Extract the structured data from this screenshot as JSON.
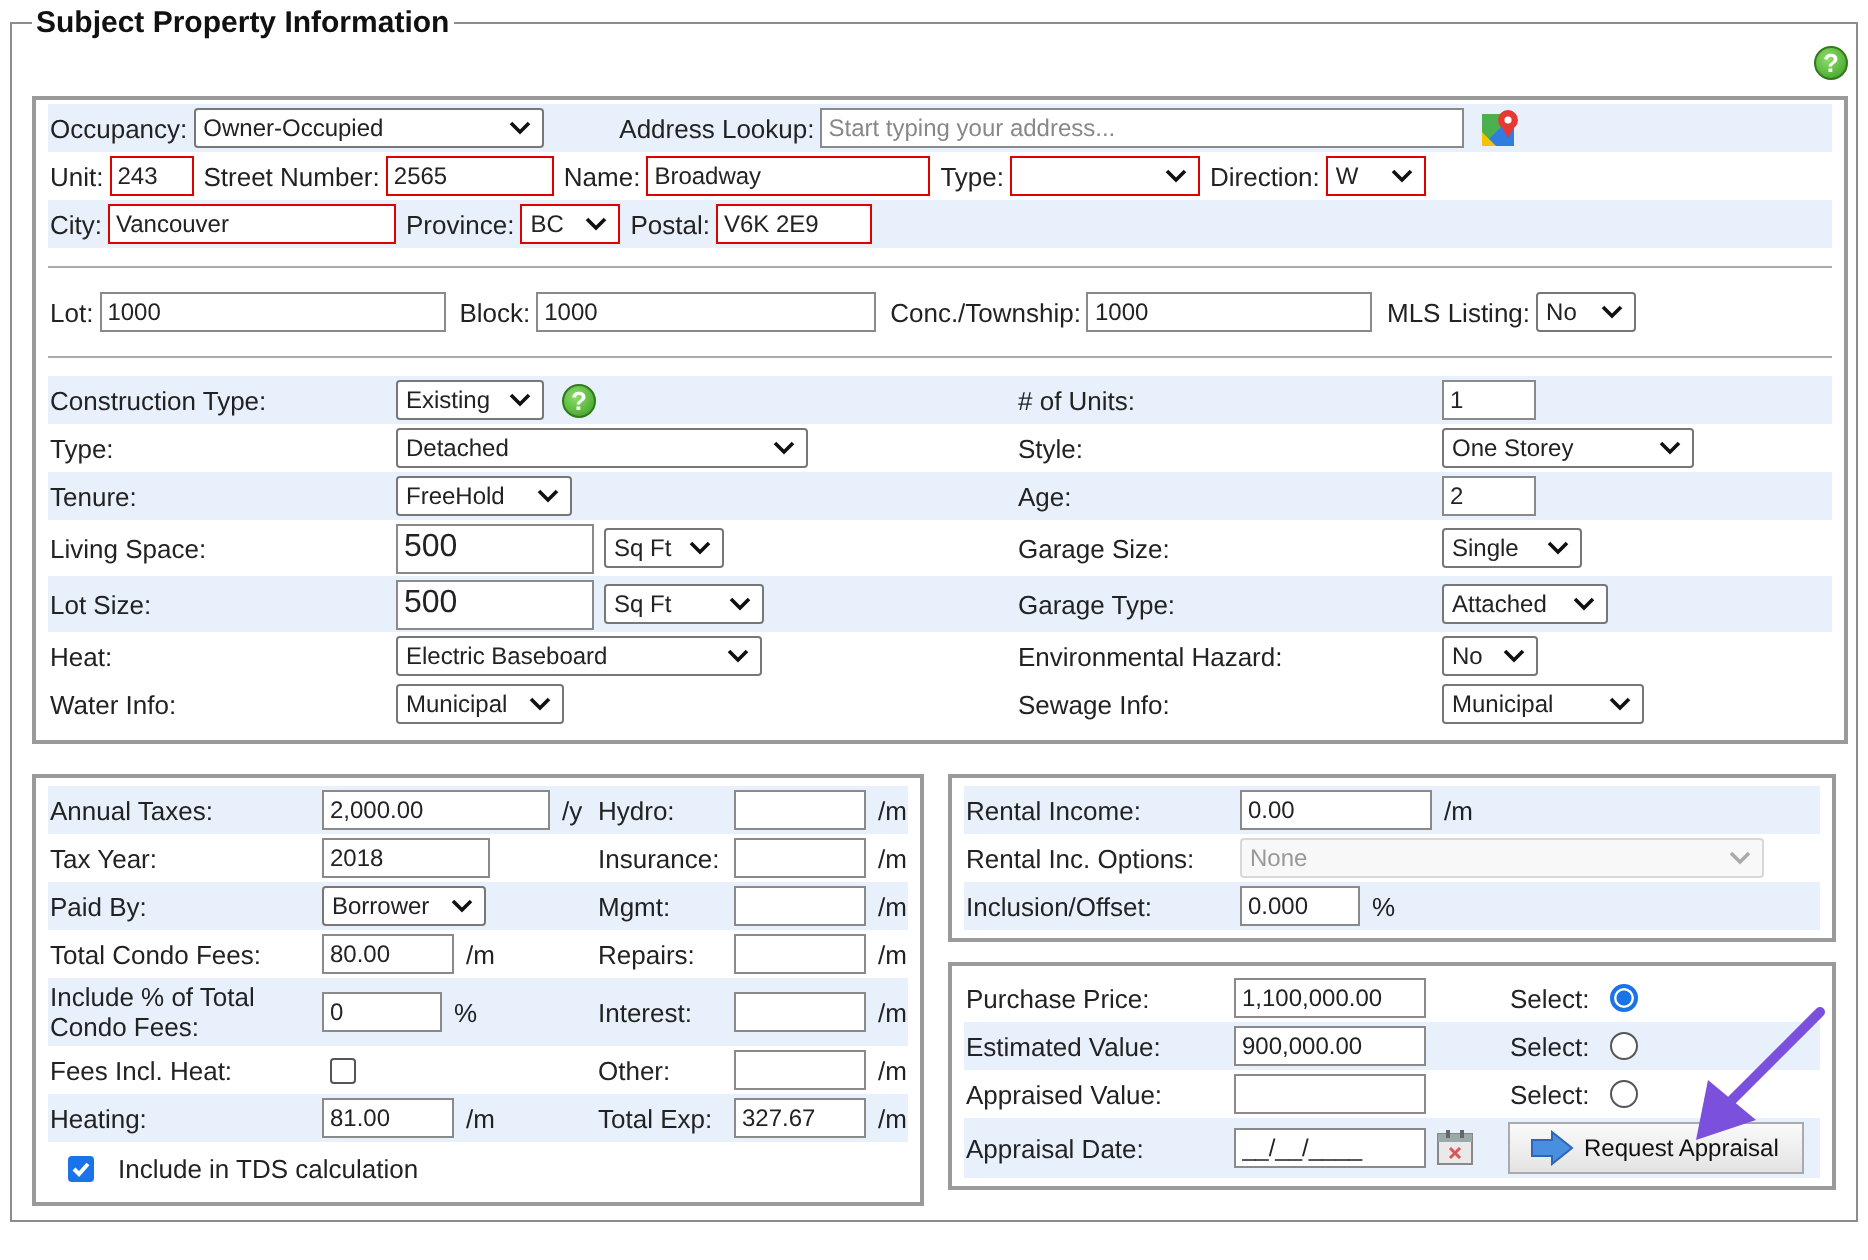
{
  "legend": "Subject Property Information",
  "help": "?",
  "address": {
    "rows": [
      {
        "shaded": true,
        "fields": [
          {
            "label": "Occupancy:",
            "kind": "select",
            "value": "Owner-Occupied"
          },
          {
            "label": "Address Lookup:",
            "kind": "text",
            "placeholder": "Start typing your address...",
            "map_button": true
          }
        ]
      },
      {
        "shaded": false,
        "fields": [
          {
            "label": "Unit:",
            "kind": "text",
            "value": "243",
            "invalid": true
          },
          {
            "label": "Street Number:",
            "kind": "text",
            "value": "2565",
            "invalid": true
          },
          {
            "label": "Name:",
            "kind": "text",
            "value": "Broadway",
            "invalid": true
          },
          {
            "label": "Type:",
            "kind": "select",
            "invalid": true
          },
          {
            "label": "Direction:",
            "kind": "select",
            "value": "W",
            "invalid": true
          }
        ]
      },
      {
        "shaded": true,
        "fields": [
          {
            "label": "City:",
            "kind": "text",
            "value": "Vancouver",
            "invalid": true
          },
          {
            "label": "Province:",
            "kind": "select",
            "value": "BC",
            "invalid": true
          },
          {
            "label": "Postal:",
            "kind": "text",
            "value": "V6K 2E9",
            "invalid": true
          }
        ]
      }
    ],
    "lot_row": [
      {
        "label": "Lot:",
        "kind": "text",
        "value": "1000"
      },
      {
        "label": "Block:",
        "kind": "text",
        "value": "1000"
      },
      {
        "label": "Conc./Township:",
        "kind": "text",
        "value": "1000"
      },
      {
        "label": "MLS Listing:",
        "kind": "select",
        "value": "No"
      }
    ]
  },
  "details": [
    {
      "shaded": true,
      "left": {
        "label": "Construction Type:",
        "controls": [
          {
            "kind": "select",
            "value": "Existing"
          }
        ],
        "help": "?"
      },
      "right": {
        "label": "# of Units:",
        "controls": [
          {
            "kind": "text",
            "value": "1"
          }
        ]
      }
    },
    {
      "shaded": false,
      "left": {
        "label": "Type:",
        "controls": [
          {
            "kind": "select",
            "value": "Detached"
          }
        ]
      },
      "right": {
        "label": "Style:",
        "controls": [
          {
            "kind": "select",
            "value": "One Storey"
          }
        ]
      }
    },
    {
      "shaded": true,
      "left": {
        "label": "Tenure:",
        "controls": [
          {
            "kind": "select",
            "value": "FreeHold"
          }
        ]
      },
      "right": {
        "label": "Age:",
        "controls": [
          {
            "kind": "text",
            "value": "2"
          }
        ]
      }
    },
    {
      "shaded": false,
      "left": {
        "label": "Living Space:",
        "controls": [
          {
            "kind": "text",
            "value": "500"
          },
          {
            "kind": "select",
            "value": "Sq Ft"
          }
        ]
      },
      "right": {
        "label": "Garage Size:",
        "controls": [
          {
            "kind": "select",
            "value": "Single"
          }
        ]
      }
    },
    {
      "shaded": true,
      "left": {
        "label": "Lot Size:",
        "controls": [
          {
            "kind": "text",
            "value": "500"
          },
          {
            "kind": "select",
            "value": "Sq Ft"
          }
        ]
      },
      "right": {
        "label": "Garage Type:",
        "controls": [
          {
            "kind": "select",
            "value": "Attached"
          }
        ]
      }
    },
    {
      "shaded": false,
      "left": {
        "label": "Heat:",
        "controls": [
          {
            "kind": "select",
            "value": "Electric Baseboard"
          }
        ]
      },
      "right": {
        "label": "Environmental Hazard:",
        "controls": [
          {
            "kind": "select",
            "value": "No"
          }
        ]
      }
    },
    {
      "shaded": false,
      "left": {
        "label": "Water Info:",
        "controls": [
          {
            "kind": "select",
            "value": "Municipal"
          }
        ]
      },
      "right": {
        "label": "Sewage Info:",
        "controls": [
          {
            "kind": "select",
            "value": "Municipal"
          }
        ]
      }
    }
  ],
  "expenses": {
    "rows": [
      {
        "shaded": true,
        "cells": [
          {
            "label": "Annual Taxes:",
            "control": {
              "kind": "text",
              "value": "2,000.00"
            },
            "unit": "/y"
          },
          {
            "label": "Hydro:",
            "control": {
              "kind": "text"
            },
            "unit": "/m"
          }
        ]
      },
      {
        "shaded": false,
        "cells": [
          {
            "label": "Tax Year:",
            "control": {
              "kind": "text",
              "value": "2018"
            }
          },
          {
            "label": "Insurance:",
            "control": {
              "kind": "text"
            },
            "unit": "/m"
          }
        ]
      },
      {
        "shaded": true,
        "cells": [
          {
            "label": "Paid By:",
            "control": {
              "kind": "select",
              "value": "Borrower"
            }
          },
          {
            "label": "Mgmt:",
            "control": {
              "kind": "text"
            },
            "unit": "/m"
          }
        ]
      },
      {
        "shaded": false,
        "cells": [
          {
            "label": "Total Condo Fees:",
            "control": {
              "kind": "text",
              "value": "80.00"
            },
            "unit": "/m"
          },
          {
            "label": "Repairs:",
            "control": {
              "kind": "text"
            },
            "unit": "/m"
          }
        ]
      },
      {
        "shaded": true,
        "cells": [
          {
            "label": "Include % of Total Condo Fees:",
            "control": {
              "kind": "text",
              "value": "0"
            },
            "unit": "%"
          },
          {
            "label": "Interest:",
            "control": {
              "kind": "text"
            },
            "unit": "/m"
          }
        ]
      },
      {
        "shaded": false,
        "cells": [
          {
            "label": "Fees Incl. Heat:",
            "control": {
              "kind": "checkbox",
              "checked": false
            }
          },
          {
            "label": "Other:",
            "control": {
              "kind": "text"
            },
            "unit": "/m"
          }
        ]
      },
      {
        "shaded": true,
        "cells": [
          {
            "label": "Heating:",
            "control": {
              "kind": "text",
              "value": "81.00"
            },
            "unit": "/m"
          },
          {
            "label": "Total Exp:",
            "control": {
              "kind": "text",
              "value": "327.67"
            },
            "unit": "/m"
          }
        ]
      }
    ],
    "tds": {
      "label": "Include in TDS calculation",
      "checked": true
    }
  },
  "rental": {
    "rows": [
      {
        "shaded": true,
        "label": "Rental Income:",
        "control": {
          "kind": "text",
          "value": "0.00"
        },
        "unit": "/m"
      },
      {
        "shaded": false,
        "label": "Rental Inc. Options:",
        "control": {
          "kind": "select",
          "value": "None",
          "disabled": true
        }
      },
      {
        "shaded": true,
        "label": "Inclusion/Offset:",
        "control": {
          "kind": "text",
          "value": "0.000"
        },
        "unit": "%"
      }
    ]
  },
  "values": {
    "rows": [
      {
        "shaded": false,
        "label": "Purchase Price:",
        "control": {
          "kind": "text",
          "value": "1,100,000.00"
        },
        "select_label": "Select:",
        "selected": true
      },
      {
        "shaded": true,
        "label": "Estimated Value:",
        "control": {
          "kind": "text",
          "value": "900,000.00"
        },
        "select_label": "Select:",
        "selected": false
      },
      {
        "shaded": false,
        "label": "Appraised Value:",
        "control": {
          "kind": "text"
        },
        "select_label": "Select:",
        "selected": false
      },
      {
        "shaded": true,
        "label": "Appraisal Date:",
        "control": {
          "kind": "text",
          "value": "__/__/____"
        },
        "calendar_button": true,
        "action": "Request Appraisal"
      }
    ]
  }
}
